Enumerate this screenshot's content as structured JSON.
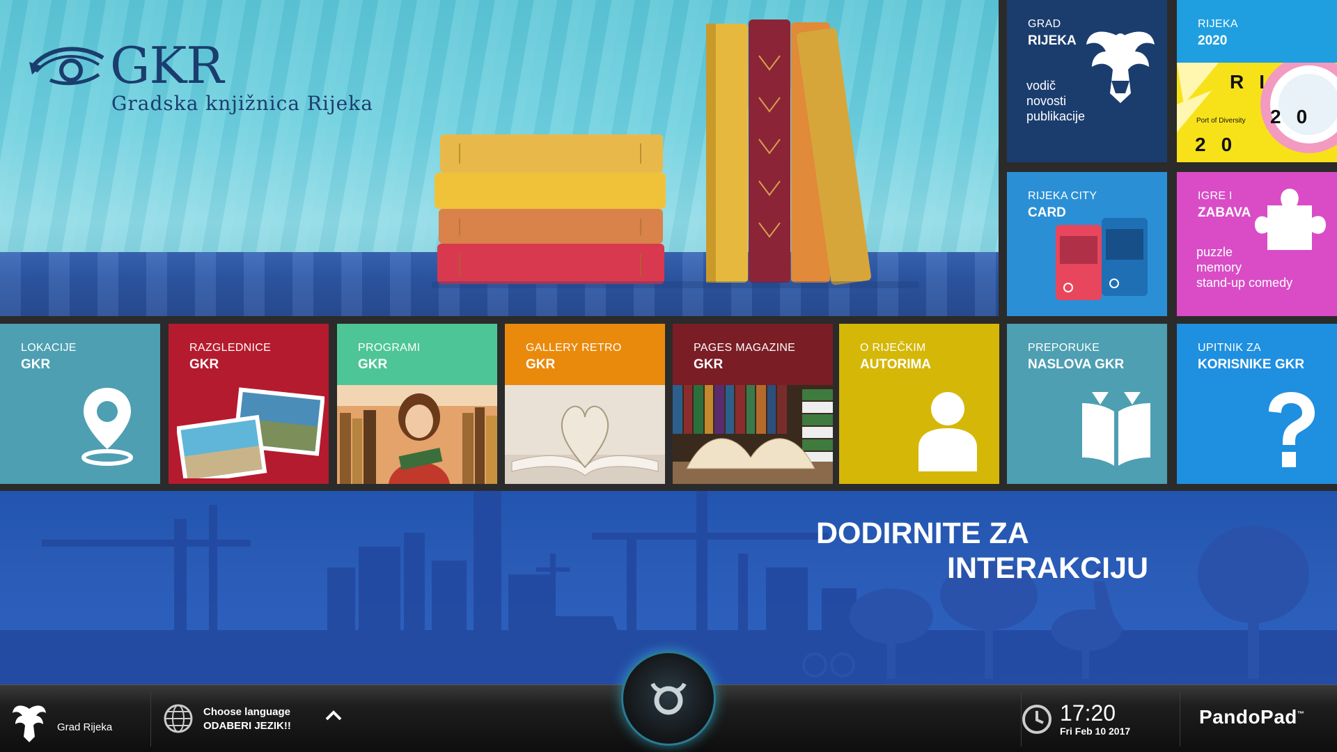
{
  "hero": {
    "logo_title": "GKR",
    "logo_subtitle": "Gradska knjižnica Rijeka"
  },
  "tiles_top": {
    "grad": {
      "line1": "GRAD",
      "line2": "RIJEKA",
      "items": [
        "vodič",
        "novosti",
        "publikacije"
      ]
    },
    "rijeka2020": {
      "line1": "RIJEKA",
      "line2": "2020",
      "poster_text": [
        "R",
        "I",
        "2",
        "0",
        "2",
        "0"
      ],
      "poster_small": "Port of Diversity"
    },
    "citycard": {
      "line1": "RIJEKA CITY",
      "line2": "CARD"
    },
    "igre": {
      "line1": "IGRE I",
      "line2": "ZABAVA",
      "items": [
        "puzzle",
        "memory",
        "stand-up comedy"
      ]
    }
  },
  "tiles_row": [
    {
      "line1": "LOKACIJE",
      "line2": "GKR"
    },
    {
      "line1": "RAZGLEDNICE",
      "line2": "GKR"
    },
    {
      "line1": "PROGRAMI",
      "line2": "GKR"
    },
    {
      "line1": "GALLERY RETRO",
      "line2": "GKR"
    },
    {
      "line1": "PAGES MAGAZINE",
      "line2": "GKR"
    },
    {
      "line1": "O RIJEČKIM",
      "line2": "AUTORIMA"
    },
    {
      "line1": "PREPORUKE",
      "line2": "NASLOVA GKR"
    },
    {
      "line1": "UPITNIK ZA",
      "line2": "KORISNIKE GKR"
    }
  ],
  "banner": {
    "line1": "DODIRNITE ZA",
    "line2": "INTERAKCIJU"
  },
  "bottom_bar": {
    "city_label": "Grad Rijeka",
    "language_label": "Choose language",
    "language_label_hr": "ODABERI JEZIK!!",
    "time": "17:20",
    "date": "Fri Feb 10 2017",
    "brand": "PandoPad",
    "brand_tm": "™"
  },
  "icons": {
    "location": "location-pin-icon",
    "author": "person-icon",
    "book": "open-book-icon",
    "question": "question-mark-icon",
    "puzzle": "puzzle-piece-icon",
    "globe": "globe-icon",
    "clock": "clock-icon",
    "chevron": "chevron-up-icon",
    "home": "home-button-icon"
  },
  "colors": {
    "navy": "#1b3d6e",
    "teal": "#4e9fb2",
    "red": "#b51b2e",
    "green": "#4ec596",
    "orange": "#ea8a0c",
    "maroon": "#7a1d25",
    "yellow": "#d5b707",
    "blue": "#1f8fe0",
    "magenta": "#d94cc6",
    "banner_blue": "#2a5cb8"
  }
}
